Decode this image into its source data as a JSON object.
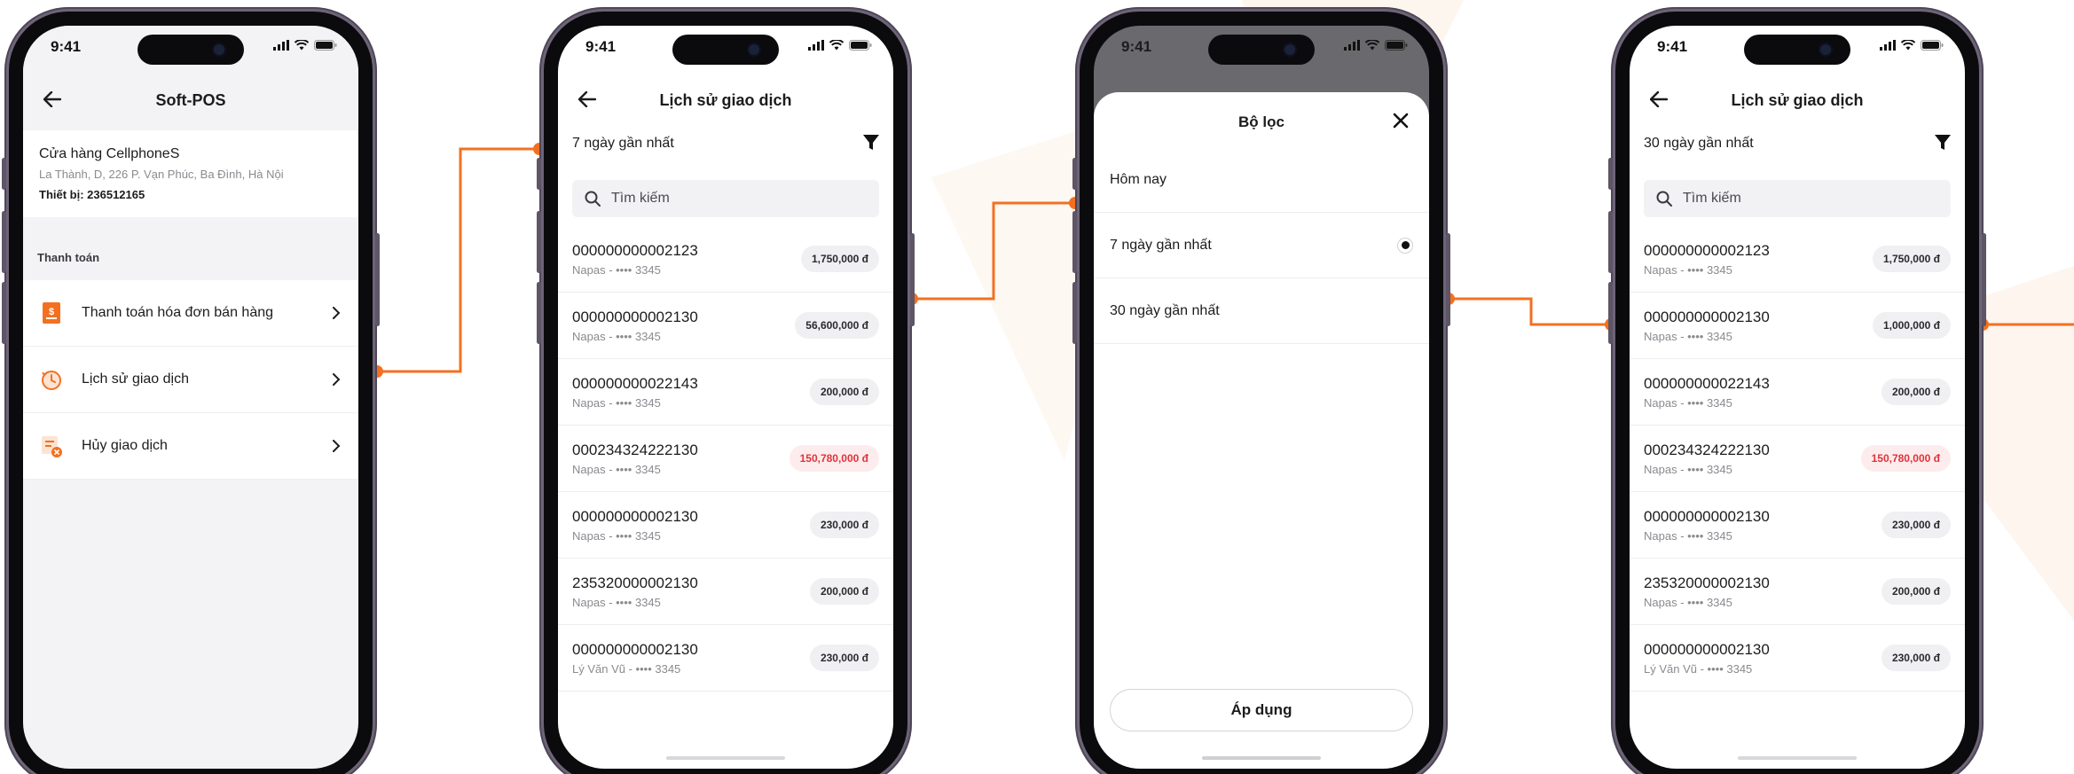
{
  "colors": {
    "accent": "#f37021",
    "danger": "#e2323a"
  },
  "status": {
    "time": "9:41"
  },
  "screen1": {
    "title": "Soft-POS",
    "store": {
      "name": "Cửa hàng CellphoneS",
      "address": "La Thành, D, 226 P. Vạn Phúc, Ba Đình, Hà Nội",
      "device": "Thiết bị: 236512165"
    },
    "section": "Thanh toán",
    "menu": [
      {
        "label": "Thanh toán hóa đơn bán hàng",
        "icon": "invoice-icon"
      },
      {
        "label": "Lịch sử giao dịch",
        "icon": "history-icon"
      },
      {
        "label": "Hủy giao dịch",
        "icon": "cancel-document-icon"
      }
    ]
  },
  "screen2": {
    "title": "Lịch sử giao dịch",
    "filter": "7 ngày gần nhất",
    "search_placeholder": "Tìm kiếm",
    "items": [
      {
        "id": "000000000002123",
        "sub": "Napas - •••• 3345",
        "amount": "1,750,000 đ",
        "negative": false
      },
      {
        "id": "000000000002130",
        "sub": "Napas - •••• 3345",
        "amount": "56,600,000 đ",
        "negative": false
      },
      {
        "id": "000000000022143",
        "sub": "Napas  - •••• 3345",
        "amount": "200,000 đ",
        "negative": false
      },
      {
        "id": "000234324222130",
        "sub": "Napas - •••• 3345",
        "amount": "150,780,000 đ",
        "negative": true
      },
      {
        "id": "000000000002130",
        "sub": "Napas - •••• 3345",
        "amount": "230,000 đ",
        "negative": false
      },
      {
        "id": "235320000002130",
        "sub": "Napas - •••• 3345",
        "amount": "200,000 đ",
        "negative": false
      },
      {
        "id": "000000000002130",
        "sub": "Lý Văn Vũ - •••• 3345",
        "amount": "230,000 đ",
        "negative": false
      }
    ]
  },
  "screen3": {
    "title": "Bộ lọc",
    "options": [
      "Hôm nay",
      "7 ngày gần nhất",
      "30 ngày gần nhất"
    ],
    "selected_option": "7 ngày gần nhất",
    "apply": "Áp dụng"
  },
  "screen4": {
    "title": "Lịch sử giao dịch",
    "filter": "30 ngày gần nhất",
    "search_placeholder": "Tìm kiếm",
    "items": [
      {
        "id": "000000000002123",
        "sub": "Napas - •••• 3345",
        "amount": "1,750,000 đ",
        "negative": false
      },
      {
        "id": "000000000002130",
        "sub": "Napas - •••• 3345",
        "amount": "1,000,000 đ",
        "negative": false
      },
      {
        "id": "000000000022143",
        "sub": "Napas  - •••• 3345",
        "amount": "200,000 đ",
        "negative": false
      },
      {
        "id": "000234324222130",
        "sub": "Napas - •••• 3345",
        "amount": "150,780,000 đ",
        "negative": true
      },
      {
        "id": "000000000002130",
        "sub": "Napas - •••• 3345",
        "amount": "230,000 đ",
        "negative": false
      },
      {
        "id": "235320000002130",
        "sub": "Napas - •••• 3345",
        "amount": "200,000 đ",
        "negative": false
      },
      {
        "id": "000000000002130",
        "sub": "Lý Văn Vũ - •••• 3345",
        "amount": "230,000 đ",
        "negative": false
      }
    ]
  }
}
